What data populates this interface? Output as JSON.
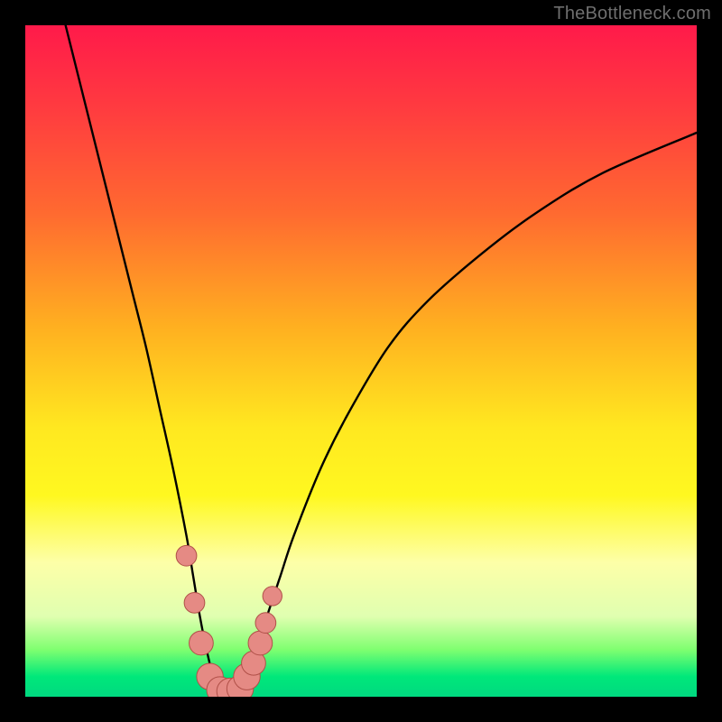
{
  "watermark": "TheBottleneck.com",
  "colors": {
    "frame": "#000000",
    "curve": "#000000",
    "marker_fill": "#e58a84",
    "marker_stroke": "#b05048",
    "gradient_stops": [
      "#ff1a4a",
      "#ff3a40",
      "#ff6a30",
      "#ffb020",
      "#ffe820",
      "#fff820",
      "#fdffa8",
      "#e0ffb0",
      "#7fff70",
      "#00e87a",
      "#00d880"
    ]
  },
  "chart_data": {
    "type": "line",
    "title": "",
    "xlabel": "",
    "ylabel": "",
    "xlim": [
      0,
      100
    ],
    "ylim": [
      0,
      100
    ],
    "series": [
      {
        "name": "curve",
        "x": [
          6,
          8,
          10,
          12,
          14,
          16,
          18,
          20,
          22,
          24,
          25,
          26,
          27,
          28,
          29,
          30,
          31,
          32,
          33,
          34,
          36,
          38,
          40,
          44,
          48,
          54,
          60,
          68,
          76,
          86,
          100
        ],
        "y": [
          100,
          92,
          84,
          76,
          68,
          60,
          52,
          43,
          34,
          24,
          18,
          12,
          7,
          3,
          1,
          0.5,
          0.5,
          1,
          3,
          6,
          12,
          18,
          24,
          34,
          42,
          52,
          59,
          66,
          72,
          78,
          84
        ]
      }
    ],
    "markers": [
      {
        "x": 24.0,
        "y": 21,
        "r": 1.1
      },
      {
        "x": 25.2,
        "y": 14,
        "r": 1.1
      },
      {
        "x": 26.2,
        "y": 8,
        "r": 1.4
      },
      {
        "x": 27.5,
        "y": 3,
        "r": 1.6
      },
      {
        "x": 29.0,
        "y": 1,
        "r": 1.6
      },
      {
        "x": 30.5,
        "y": 0.8,
        "r": 1.6
      },
      {
        "x": 32.0,
        "y": 1.2,
        "r": 1.6
      },
      {
        "x": 33.0,
        "y": 3,
        "r": 1.6
      },
      {
        "x": 34.0,
        "y": 5,
        "r": 1.4
      },
      {
        "x": 35.0,
        "y": 8,
        "r": 1.4
      },
      {
        "x": 35.8,
        "y": 11,
        "r": 1.1
      },
      {
        "x": 36.8,
        "y": 15,
        "r": 1.0
      }
    ]
  }
}
